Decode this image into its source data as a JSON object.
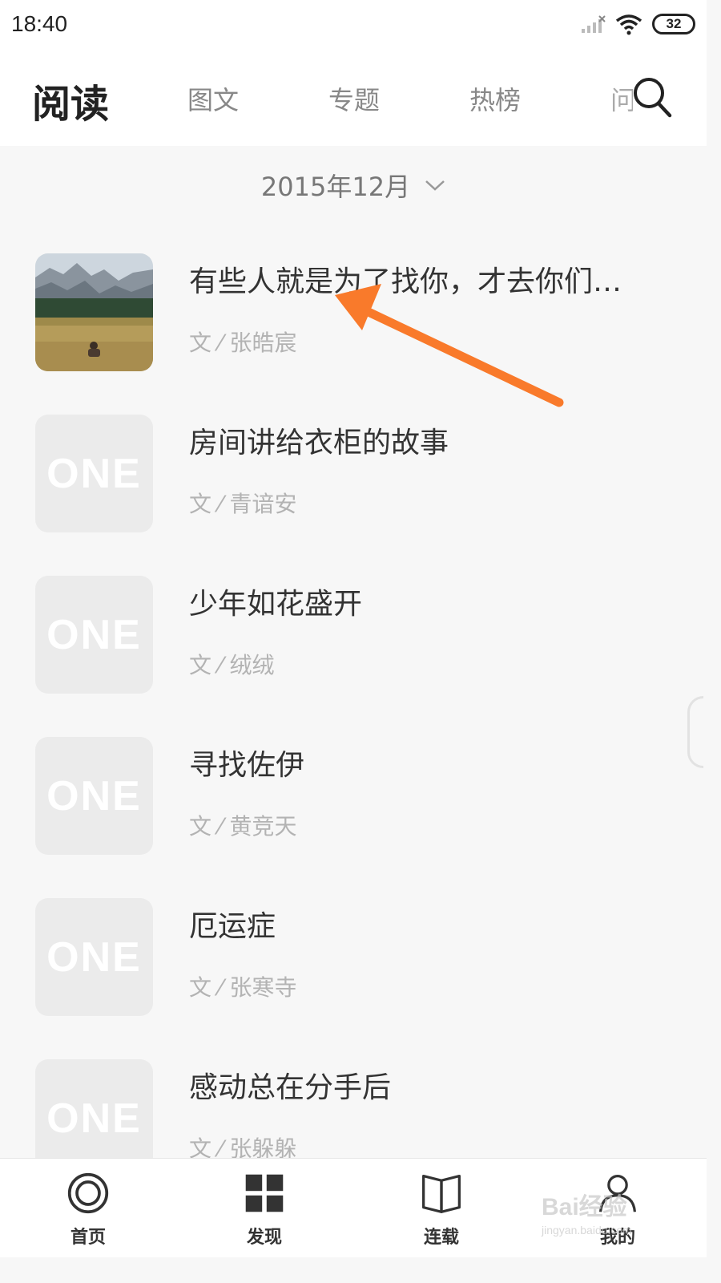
{
  "status_bar": {
    "time": "18:40",
    "battery": "32"
  },
  "header": {
    "title": "阅读",
    "tabs": [
      {
        "label": "图文"
      },
      {
        "label": "专题"
      },
      {
        "label": "热榜"
      },
      {
        "label": "问"
      }
    ]
  },
  "month_selector": {
    "label": "2015年12月"
  },
  "articles": [
    {
      "title": "有些人就是为了找你，才去你们…",
      "author": "文 ⁄ 张皓宸",
      "has_photo": true
    },
    {
      "title": "房间讲给衣柜的故事",
      "author": "文 ⁄ 青谙安",
      "thumbnail_text": "ONE"
    },
    {
      "title": "少年如花盛开",
      "author": "文 ⁄ 绒绒",
      "thumbnail_text": "ONE"
    },
    {
      "title": "寻找佐伊",
      "author": "文 ⁄ 黄竞天",
      "thumbnail_text": "ONE"
    },
    {
      "title": "厄运症",
      "author": "文 ⁄ 张寒寺",
      "thumbnail_text": "ONE"
    },
    {
      "title": "感动总在分手后",
      "author": "文 ⁄ 张躲躲",
      "thumbnail_text": "ONE"
    }
  ],
  "bottom_nav": [
    {
      "label": "首页",
      "icon": "home-circle-icon"
    },
    {
      "label": "发现",
      "icon": "grid-icon"
    },
    {
      "label": "连载",
      "icon": "book-icon"
    },
    {
      "label": "我的",
      "icon": "user-icon"
    }
  ],
  "watermark": {
    "text": "Bai经验",
    "sub": "jingyan.baidu.com"
  },
  "colors": {
    "annotation_arrow": "#f97a2b",
    "placeholder": "#ebebeb"
  }
}
